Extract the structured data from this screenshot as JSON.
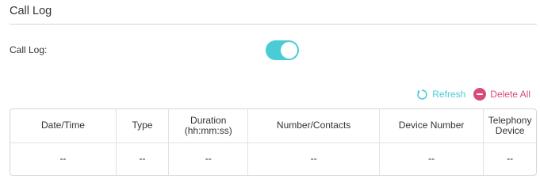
{
  "section": {
    "title": "Call Log"
  },
  "call_log_setting": {
    "label": "Call Log:",
    "enabled": true,
    "accent_color": "#4acbd6"
  },
  "actions": {
    "refresh": {
      "label": "Refresh",
      "icon": "refresh-icon",
      "color": "#4acbd6"
    },
    "delete_all": {
      "label": "Delete All",
      "icon": "minus-circle-icon",
      "color": "#d64c7a"
    }
  },
  "table": {
    "headers": {
      "date_time": "Date/Time",
      "type": "Type",
      "duration_line1": "Duration",
      "duration_line2": "(hh:mm:ss)",
      "number_contacts": "Number/Contacts",
      "device_number": "Device Number",
      "telephony_line1": "Telephony",
      "telephony_line2": "Device"
    },
    "rows": [
      {
        "date_time": "--",
        "type": "--",
        "duration": "--",
        "number_contacts": "--",
        "device_number": "--",
        "telephony_device": "--"
      }
    ]
  }
}
